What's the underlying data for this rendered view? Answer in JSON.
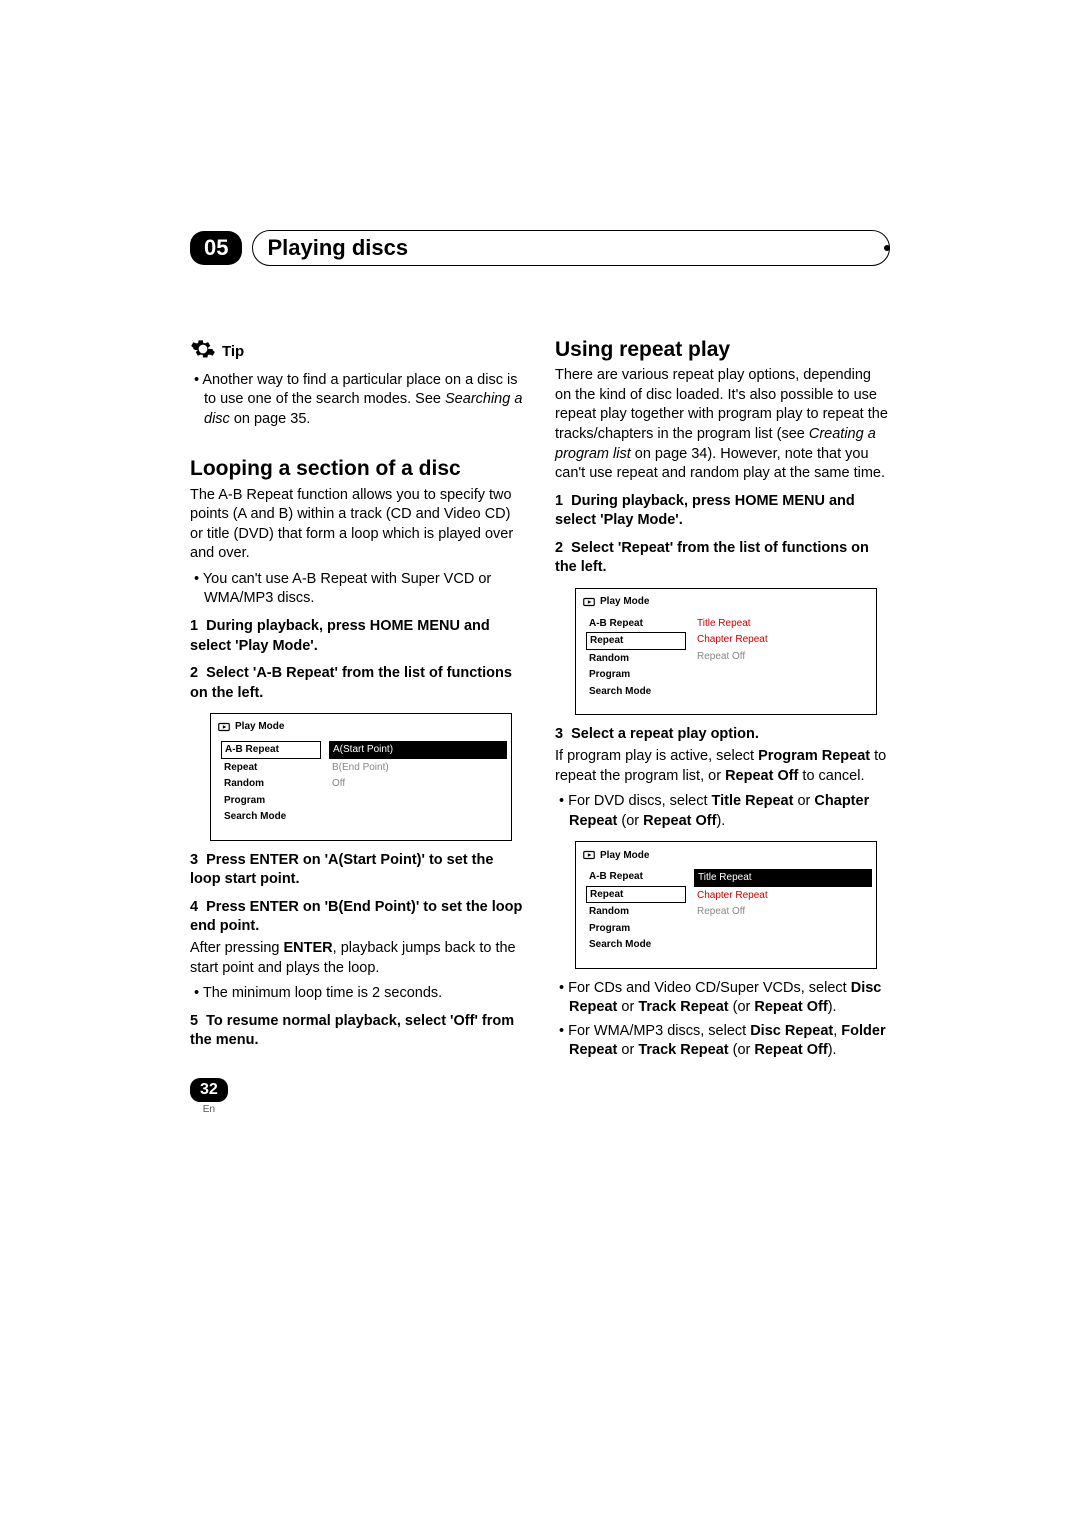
{
  "header": {
    "chapter_number": "05",
    "chapter_title": "Playing discs"
  },
  "left": {
    "tip_label": "Tip",
    "tip_text": "Another way to find a particular place on a disc is to use one of the search modes. See ",
    "tip_ref": "Searching a disc",
    "tip_after": " on page 35.",
    "looping_heading": "Looping a section of a disc",
    "looping_intro": "The A-B Repeat function allows you to specify two points (A and B) within a track (CD and Video CD) or title (DVD) that form a loop which is played over and over.",
    "looping_note": "You can't use A-B Repeat with Super VCD or WMA/MP3 discs.",
    "step1_num": "1",
    "step1_title": "During playback, press HOME MENU and select 'Play Mode'.",
    "step2_num": "2",
    "step2_title": "Select 'A-B Repeat' from the list of functions on the left.",
    "step3_num": "3",
    "step3_title": "Press ENTER on 'A(Start Point)' to set the loop start point.",
    "step4_num": "4",
    "step4_title": "Press ENTER on 'B(End Point)' to set the loop end point.",
    "after_enter_pre": "After pressing ",
    "after_enter_bold": "ENTER",
    "after_enter_post": ", playback jumps back to the start point and plays the loop.",
    "min_loop": "The minimum loop time is 2 seconds.",
    "step5_num": "5",
    "step5_title": "To resume normal playback, select 'Off' from the menu.",
    "pm1": {
      "title": "Play Mode",
      "left": [
        "A-B Repeat",
        "Repeat",
        "Random",
        "Program",
        "Search Mode"
      ],
      "left_selected_index": 0,
      "right": [
        {
          "text": "A(Start Point)",
          "style": "hl"
        },
        {
          "text": "B(End Point)",
          "style": "dim"
        },
        {
          "text": "Off",
          "style": "dim"
        }
      ]
    }
  },
  "right": {
    "repeat_heading": "Using repeat play",
    "repeat_intro_pre": "There are various repeat play options, depending on the kind of disc loaded. It's also possible to use repeat play together with program play to repeat the tracks/chapters in the program list (see ",
    "repeat_intro_ital": "Creating a program list",
    "repeat_intro_post": " on page 34). However, note that you can't use repeat and random play at the same time.",
    "rstep1_num": "1",
    "rstep1_title": "During playback, press HOME MENU and select 'Play Mode'.",
    "rstep2_num": "2",
    "rstep2_title": "Select 'Repeat' from the list of functions on the left.",
    "rstep3_num": "3",
    "rstep3_title": "Select a repeat play option.",
    "prog_line_pre": "If program play is active, select ",
    "prog_line_b1": "Program Repeat",
    "prog_line_mid": " to repeat the program list, or ",
    "prog_line_b2": "Repeat Off",
    "prog_line_post": " to cancel.",
    "dvd_line_pre": "For DVD discs, select ",
    "dvd_line_b1": "Title Repeat",
    "dvd_line_mid": " or ",
    "dvd_line_b2": "Chapter Repeat",
    "dvd_line_paren": " (or ",
    "dvd_line_b3": "Repeat Off",
    "dvd_line_end": ").",
    "cd_line_pre": "For CDs and Video CD/Super VCDs, select ",
    "cd_line_b1": "Disc Repeat",
    "cd_line_mid": " or ",
    "cd_line_b2": "Track Repeat",
    "cd_line_paren": " (or ",
    "cd_line_b3": "Repeat Off",
    "cd_line_end": ").",
    "wma_line_pre": "For WMA/MP3 discs, select ",
    "wma_line_b1": "Disc Repeat",
    "wma_line_c1": ", ",
    "wma_line_b2": "Folder Repeat",
    "wma_line_mid": " or ",
    "wma_line_b3": "Track Repeat",
    "wma_line_paren": " (or ",
    "wma_line_b4": "Repeat Off",
    "wma_line_end": ").",
    "pm2": {
      "title": "Play Mode",
      "left": [
        "A-B Repeat",
        "Repeat",
        "Random",
        "Program",
        "Search Mode"
      ],
      "left_selected_index": 1,
      "right": [
        {
          "text": "Title Repeat",
          "style": "red"
        },
        {
          "text": "Chapter Repeat",
          "style": "red"
        },
        {
          "text": "Repeat Off",
          "style": "dim"
        }
      ]
    },
    "pm3": {
      "title": "Play Mode",
      "left": [
        "A-B Repeat",
        "Repeat",
        "Random",
        "Program",
        "Search Mode"
      ],
      "left_selected_index": 1,
      "right": [
        {
          "text": "Title Repeat",
          "style": "hl"
        },
        {
          "text": "Chapter Repeat",
          "style": "red"
        },
        {
          "text": "Repeat Off",
          "style": "dim"
        }
      ]
    }
  },
  "footer": {
    "page_number": "32",
    "lang": "En"
  }
}
